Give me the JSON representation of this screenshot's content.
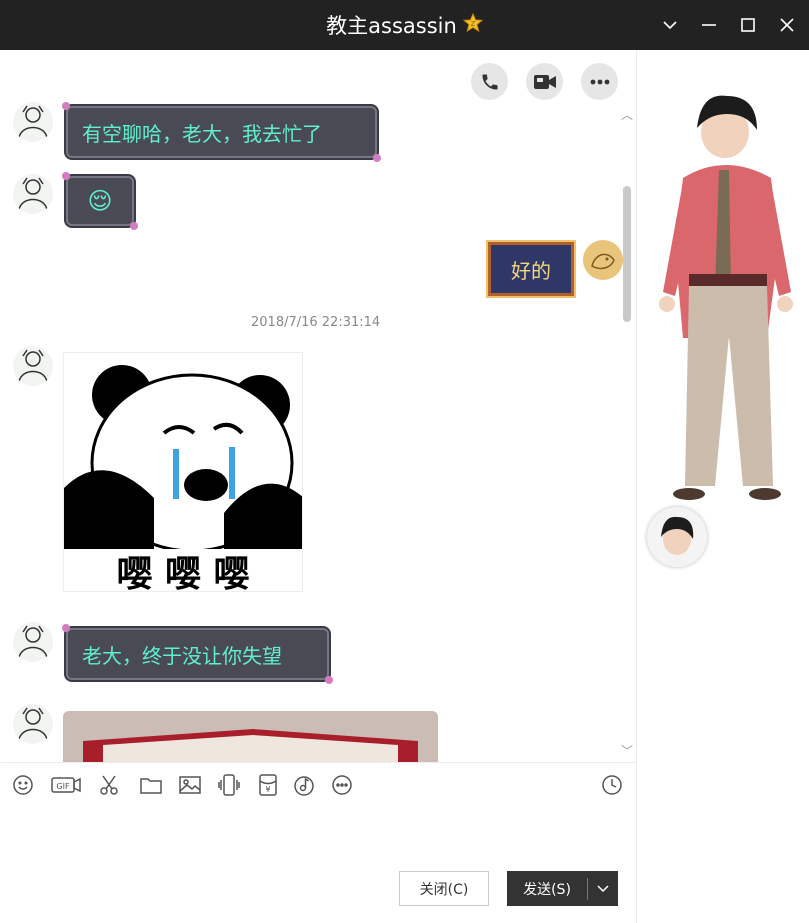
{
  "window": {
    "title": "教主assassin",
    "title_badge_icon": "star-badge-icon"
  },
  "chat": {
    "messages": [
      {
        "side": "left",
        "type": "text",
        "text": "有空聊哈，老大，我去忙了"
      },
      {
        "side": "left",
        "type": "emoji",
        "text": "😌"
      },
      {
        "side": "right",
        "type": "text",
        "text": "好的"
      },
      {
        "side": "system",
        "type": "timestamp",
        "text": "2018/7/16 22:31:14"
      },
      {
        "side": "left",
        "type": "sticker",
        "caption": "嘤 嘤 嘤"
      },
      {
        "side": "left",
        "type": "text",
        "text": "老大，终于没让你失望"
      },
      {
        "side": "left",
        "type": "image",
        "text": ""
      }
    ]
  },
  "toolbar": {
    "icons": [
      "emoji-icon",
      "gif-icon",
      "scissors-icon",
      "folder-icon",
      "image-icon",
      "shake-icon",
      "red-packet-icon",
      "music-icon",
      "more-icon",
      "history-icon"
    ]
  },
  "actions": {
    "close_label": "关闭(C)",
    "send_label": "发送(S)"
  },
  "colors": {
    "titlebar": "#222222",
    "bubble_left_bg": "#4a4a55",
    "bubble_left_text": "#5ff0d0",
    "bubble_right_bg": "#2e3767",
    "bubble_right_text": "#f3d77e"
  }
}
